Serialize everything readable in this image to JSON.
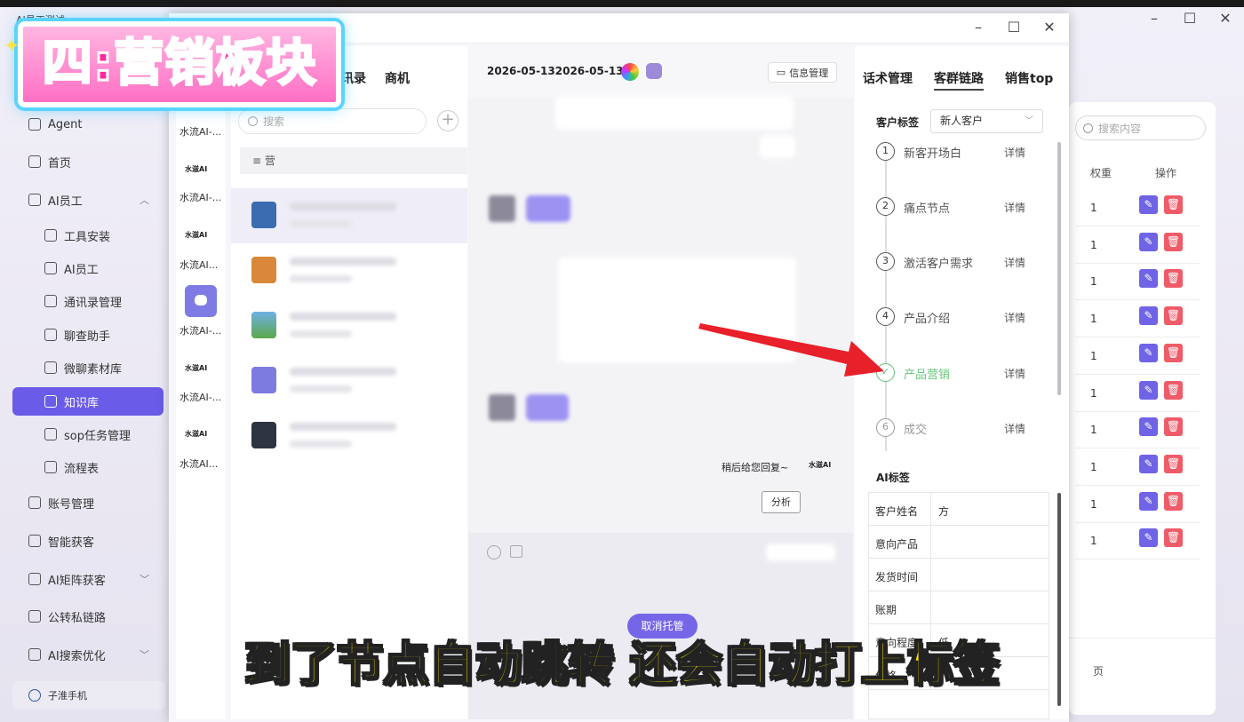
{
  "app": {
    "title": "AI员工测试"
  },
  "overlay": {
    "banner": "四:营销板块",
    "subtitle": "到了节点自动跳转 还会自动打上标签"
  },
  "sidebar": {
    "items": [
      {
        "label": "Agent"
      },
      {
        "label": "首页"
      },
      {
        "label": "AI员工"
      },
      {
        "label": "工具安装"
      },
      {
        "label": "AI员工"
      },
      {
        "label": "通讯录管理"
      },
      {
        "label": "聊查助手"
      },
      {
        "label": "微聊素材库"
      },
      {
        "label": "知识库"
      },
      {
        "label": "sop任务管理"
      },
      {
        "label": "流程表"
      },
      {
        "label": "账号管理"
      },
      {
        "label": "智能获客"
      },
      {
        "label": "AI矩阵获客"
      },
      {
        "label": "公转私链路"
      },
      {
        "label": "AI搜索优化"
      }
    ],
    "footer": "子淮手机"
  },
  "back_panel": {
    "search_placeholder": "搜索内容",
    "col_weight": "权重",
    "col_action": "操作",
    "rows": [
      "1",
      "1",
      "1",
      "1",
      "1",
      "1",
      "1",
      "1",
      "1",
      "1"
    ],
    "page_suffix": "页"
  },
  "narrow_col": {
    "label": "水流AI-...",
    "label2": "水流AI...",
    "brand": "水滋AI"
  },
  "chat_list": {
    "tab1": "讯录",
    "tab2": "商机",
    "search_placeholder": "搜索",
    "group": "≡ 营"
  },
  "chat": {
    "title": "2026-05-132026-05-131",
    "info_button": "信息管理",
    "reply": "稍后给您回复~",
    "reply_brand": "水滋AI",
    "analyze": "分析",
    "cancel_hosting": "取消托管"
  },
  "right_panel": {
    "tabs": [
      "话术管理",
      "客群链路",
      "销售top"
    ],
    "tag_label": "客户标签",
    "tag_value": "新人客户",
    "steps": [
      {
        "num": "1",
        "label": "新客开场白",
        "detail": "详情"
      },
      {
        "num": "2",
        "label": "痛点节点",
        "detail": "详情"
      },
      {
        "num": "3",
        "label": "激活客户需求",
        "detail": "详情"
      },
      {
        "num": "4",
        "label": "产品介绍",
        "detail": "详情"
      },
      {
        "num": "✓",
        "label": "产品营销",
        "detail": "详情"
      },
      {
        "num": "6",
        "label": "成交",
        "detail": "详情"
      }
    ],
    "ai_label": "AI标签",
    "ai_rows": [
      {
        "key": "客户姓名",
        "value": "方"
      },
      {
        "key": "意向产品",
        "value": ""
      },
      {
        "key": "发货时间",
        "value": ""
      },
      {
        "key": "账期",
        "value": ""
      },
      {
        "key": "意向程度",
        "value": "低"
      },
      {
        "key": "价格",
        "value": ""
      }
    ]
  },
  "colors": {
    "accent": "#6a5ce8",
    "done": "#5fbf77",
    "arrow": "#e8202a"
  }
}
